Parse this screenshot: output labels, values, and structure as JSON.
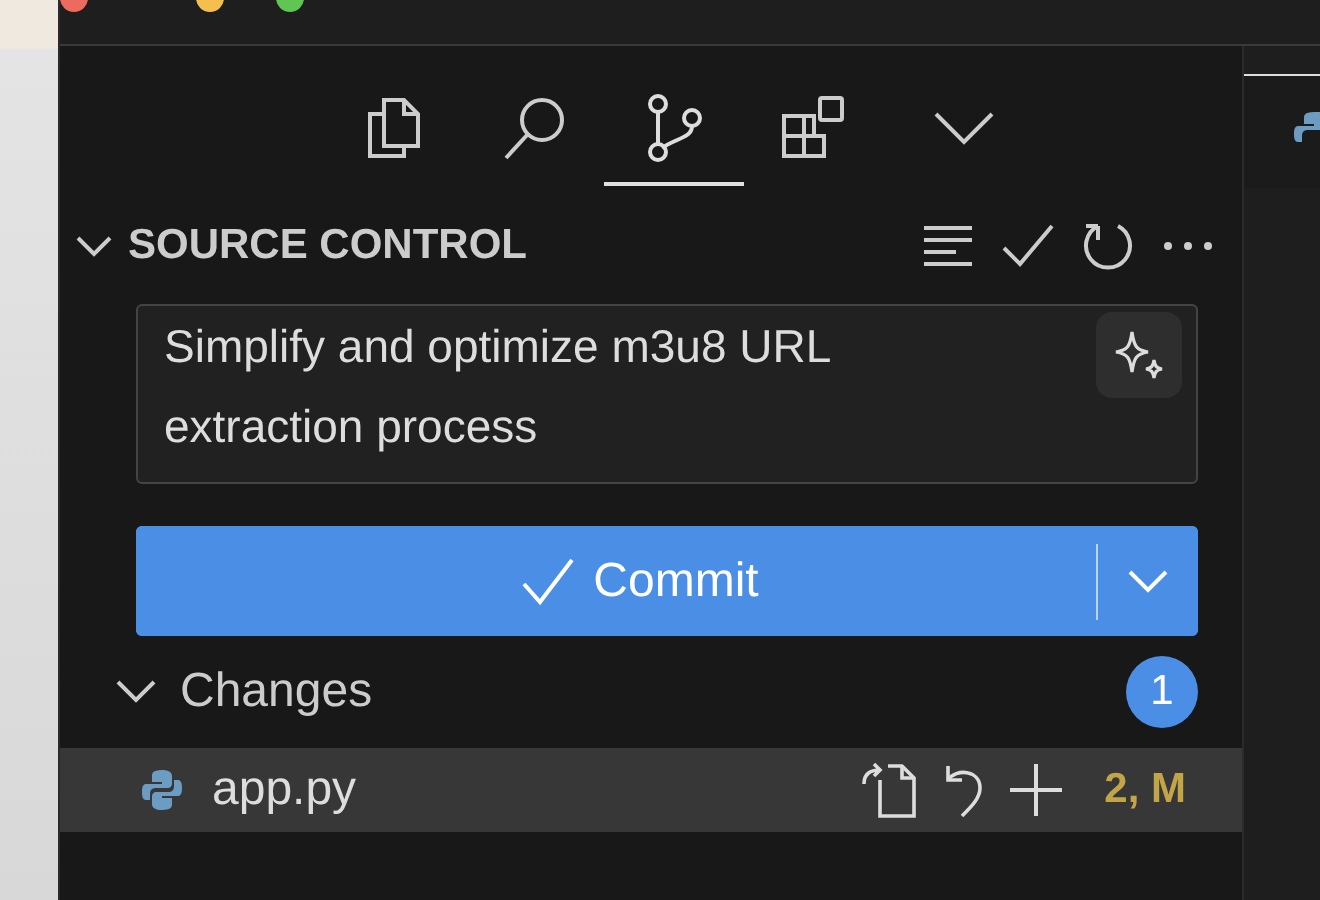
{
  "activity_tabs": [
    {
      "kind": "explorer",
      "selected": false
    },
    {
      "kind": "search",
      "selected": false
    },
    {
      "kind": "source-control",
      "selected": true
    },
    {
      "kind": "extensions",
      "selected": false
    },
    {
      "kind": "more",
      "selected": false
    }
  ],
  "panel": {
    "title": "SOURCE CONTROL",
    "expanded": true
  },
  "commit_message": {
    "value": "Simplify and optimize m3u8 URL extraction process"
  },
  "commit_button": {
    "label": "Commit"
  },
  "changes": {
    "label": "Changes",
    "expanded": true,
    "count": "1",
    "files": [
      {
        "name": "app.py",
        "status": "2, M",
        "selected": true
      }
    ]
  }
}
